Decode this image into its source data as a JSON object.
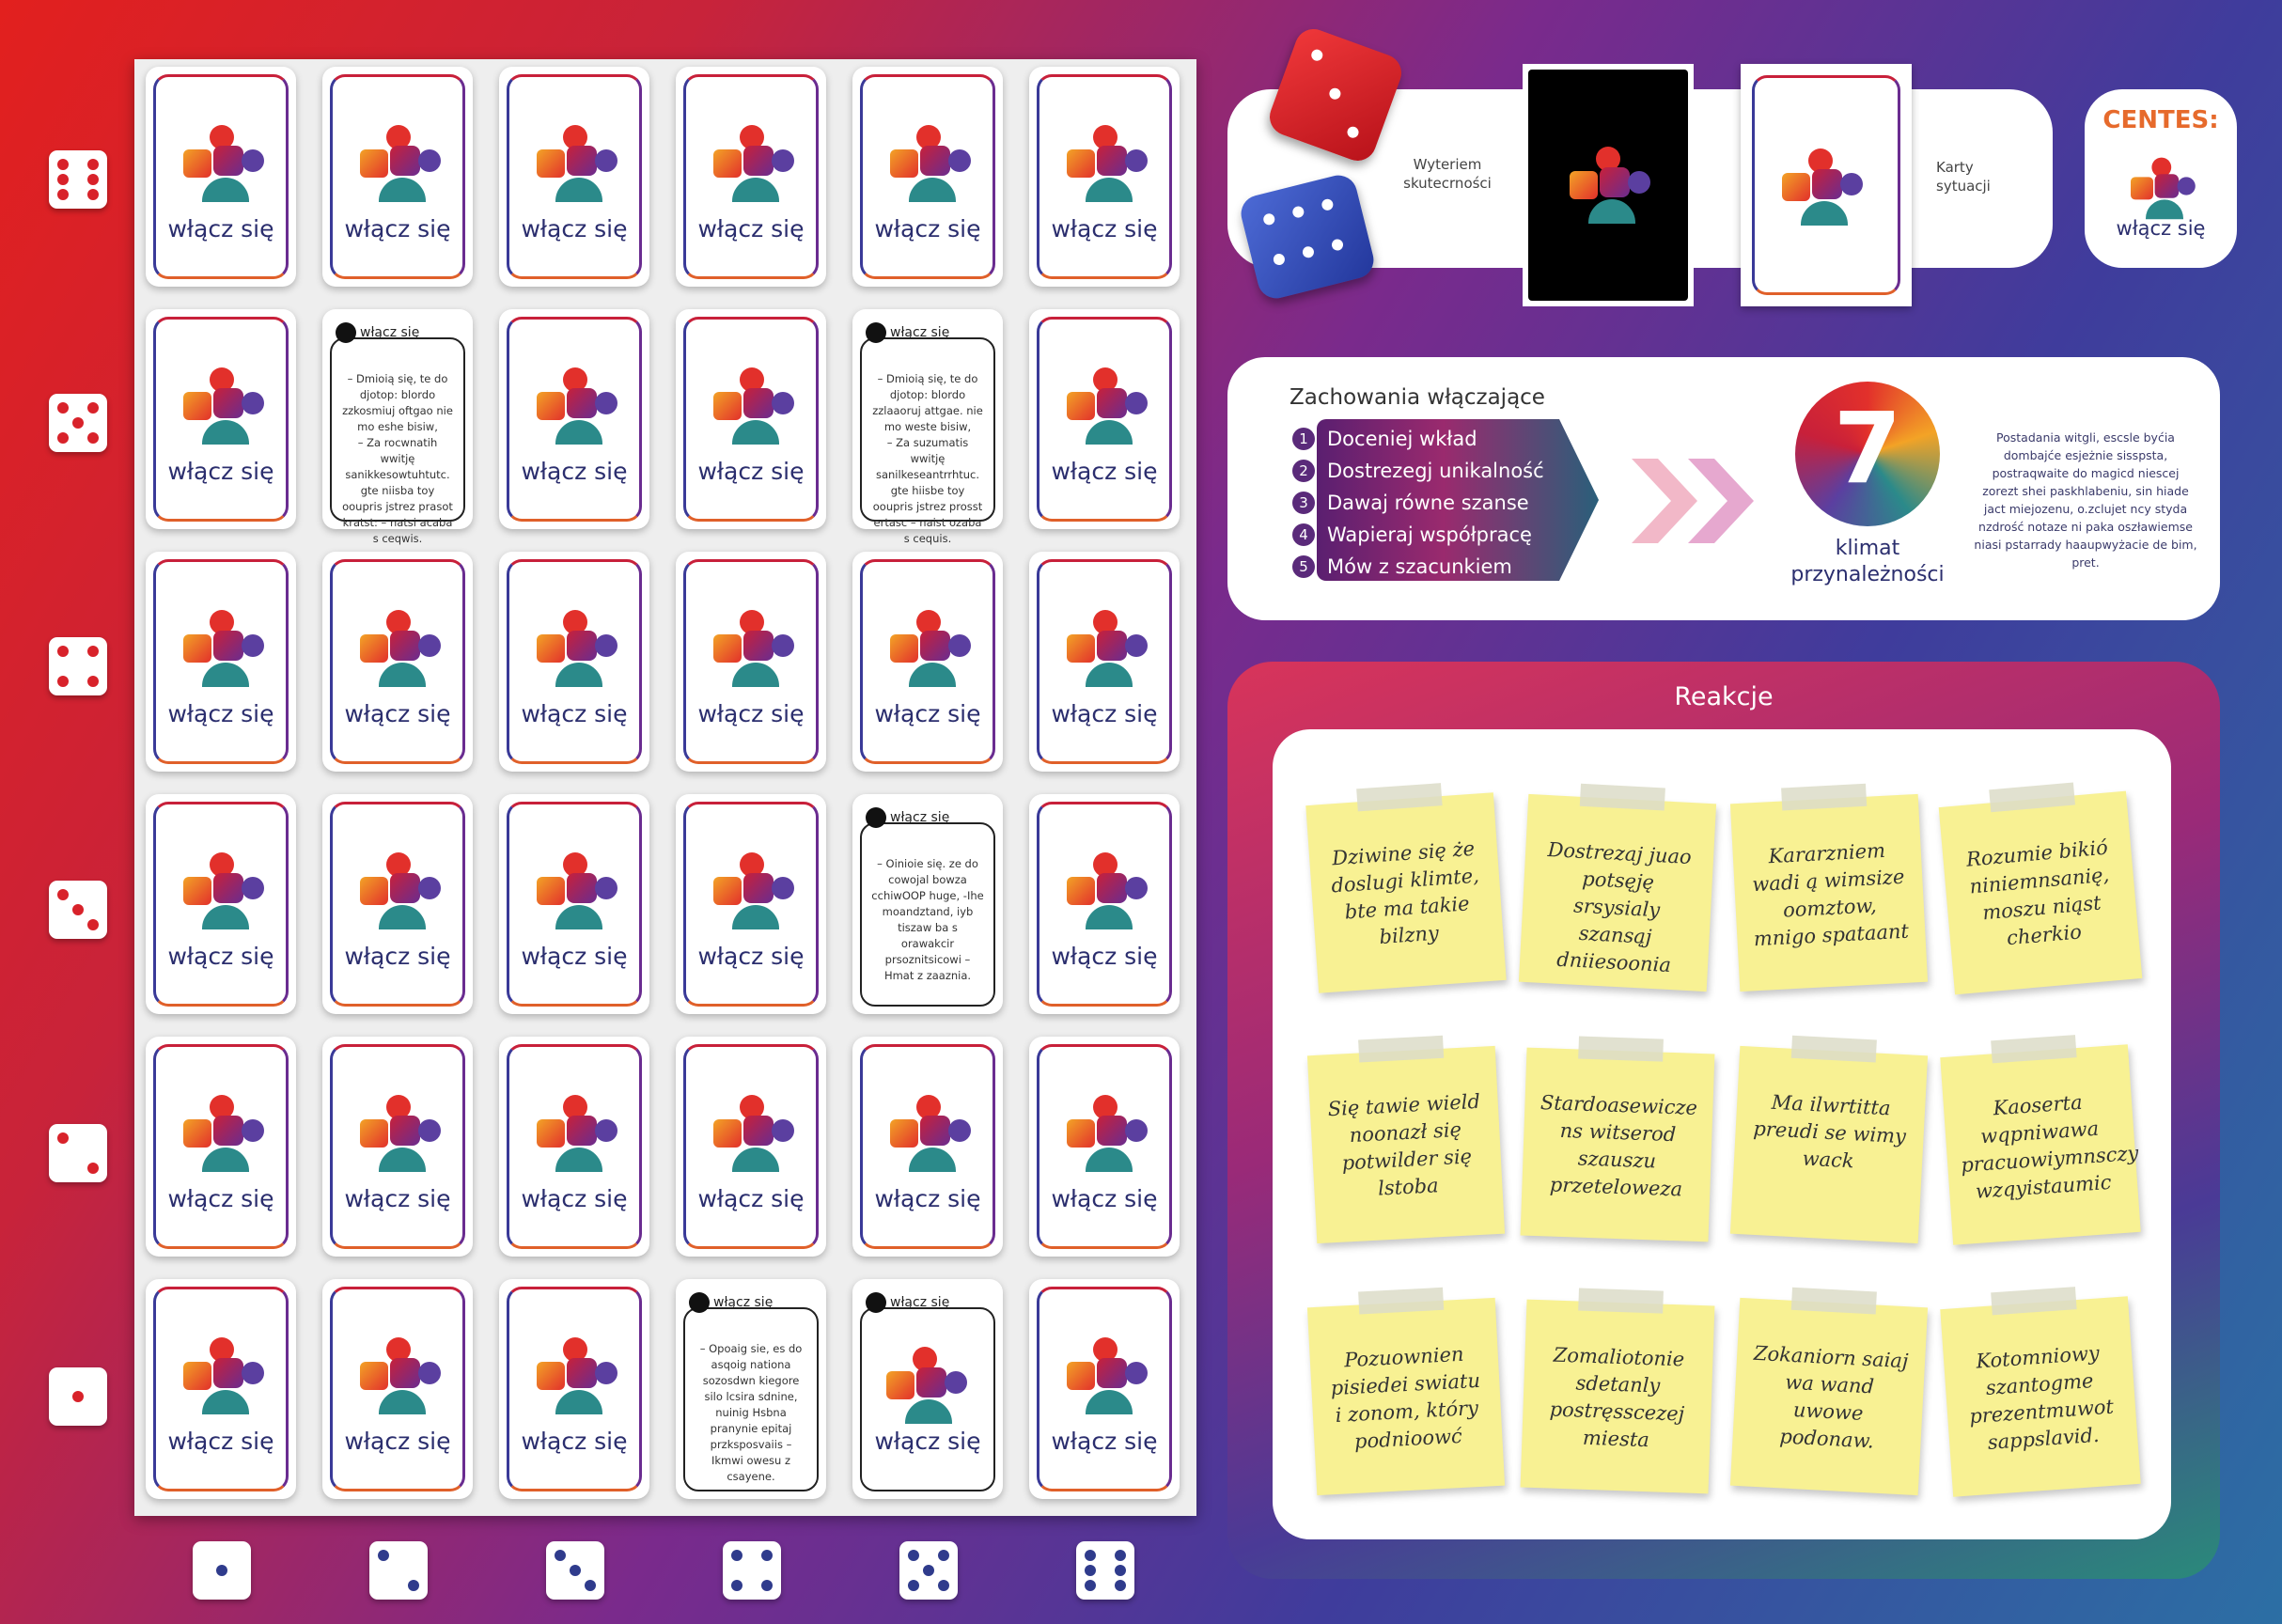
{
  "grid": {
    "brand": "włącz się",
    "text_card_header": "włącz się",
    "text_cards": {
      "r1c1": "– Dmioią się, te do djotop: blordo zzkosmiuj oftgao nie mo eshe bisiw,\n– Za rocwnatih wwitję sanikkesowtuhtutc. gte niisba toy ooupris jstrez prasot kratst: – natsi acaba s ceqwis.",
      "r1c4": "– Dmioią się, te do djotop: blordo zzlaaoruj attgae. nie mo weste bisiw,\n– Za suzumatis wwitję sanilkeseantrrhtuc. gte hiisbe toy ooupris jstrez prosst ertasc – naist ozaba s cequis.",
      "r3c4": "– Oinioie się. ze do cowojal bowza cchiwOOP huge, -Ihe moandztand, iyb tiszaw ba s orawakcir prsoznitsicowi – Hmat z zaaznia.",
      "r5c3": "– Opoaig sie, es do asqoig nationa sozosdwn kiegore silo lcsira sdnine, nuinig Hsbna pranynie epitaj przksposvaiis – Ikmwi owesu z csayene."
    },
    "card_types": [
      [
        "logo",
        "logo",
        "logo",
        "logo",
        "logo",
        "logo"
      ],
      [
        "logo",
        "text",
        "logo",
        "logo",
        "text",
        "logo"
      ],
      [
        "logo",
        "logo",
        "logo",
        "logo",
        "logo",
        "logo"
      ],
      [
        "logo",
        "logo",
        "logo",
        "logo",
        "text",
        "logo"
      ],
      [
        "logo",
        "logo",
        "logo",
        "logo",
        "logo",
        "logo"
      ],
      [
        "logo",
        "logo",
        "logo",
        "text",
        "logo_header",
        "logo"
      ]
    ],
    "row_dice": [
      6,
      5,
      4,
      3,
      2,
      1
    ],
    "col_dice": [
      1,
      2,
      3,
      4,
      5,
      6
    ]
  },
  "top_panel": {
    "criterion_label": "Wyteriem skutecrności",
    "situations_label": "Karty sytuacji",
    "centes_label": "CENTES:",
    "centes_brand": "włącz się"
  },
  "behaviors": {
    "title": "Zachowania włączające",
    "items": [
      {
        "n": "1",
        "label": "Doceniej wkład"
      },
      {
        "n": "2",
        "label": "Dostrezegj unikalność"
      },
      {
        "n": "3",
        "label": "Dawaj równe szanse"
      },
      {
        "n": "4",
        "label": "Wapieraj współpracę"
      },
      {
        "n": "5",
        "label": "Mów z szacunkiem"
      }
    ],
    "climat_number": "7",
    "climat_label": "klimat przynależności",
    "description": "Postadania witgli, escsle byćia dombajće esjeżnie sisspsta, postraqwaite do magicd niescej zorezt shei paskhlabeniu, sin hiade jact miejozenu, o.zclujet ncy styda nzdrość notaze ni paka oszławiemse niasi pstarrady haaupwyżacie de bim, pret."
  },
  "reactions": {
    "title": "Reakcje",
    "notes": [
      "Dziwine się że doslugi klimte, bte ma takie bilzny",
      "Dostrezaj juao potsęję srsysialy szansąj dniiesoonia",
      "Kararzniem wadi ą wimsize oomztow, mnigo spataant",
      "Rozumie bikió niniemnsanię, moszu niąst cherkio",
      "Się tawie wield noonazł się potwilder się lstoba",
      "Stardoasewicze ns witserod szauszu przeteloweza",
      "Ma ilwrtitta preudi se wimy wack",
      "Kaoserta wqpniwawa pracuowiymnsczy wzqyistaumic",
      "Pozuownien pisiedei swiatu i zonom, który podnioowć",
      "Zomaliotonie sdetanly postręsscezej miesta",
      "Zokaniorn saiaj wa wand uwowe podonaw.",
      "Kotomniowy szantogme prezentmuwot sappslavid."
    ]
  },
  "colors": {
    "red_pip": "#d8222a",
    "blue_pip": "#2f3b8c",
    "note_yellow": "#f8f193",
    "brand_navy": "#2b2e6e"
  }
}
